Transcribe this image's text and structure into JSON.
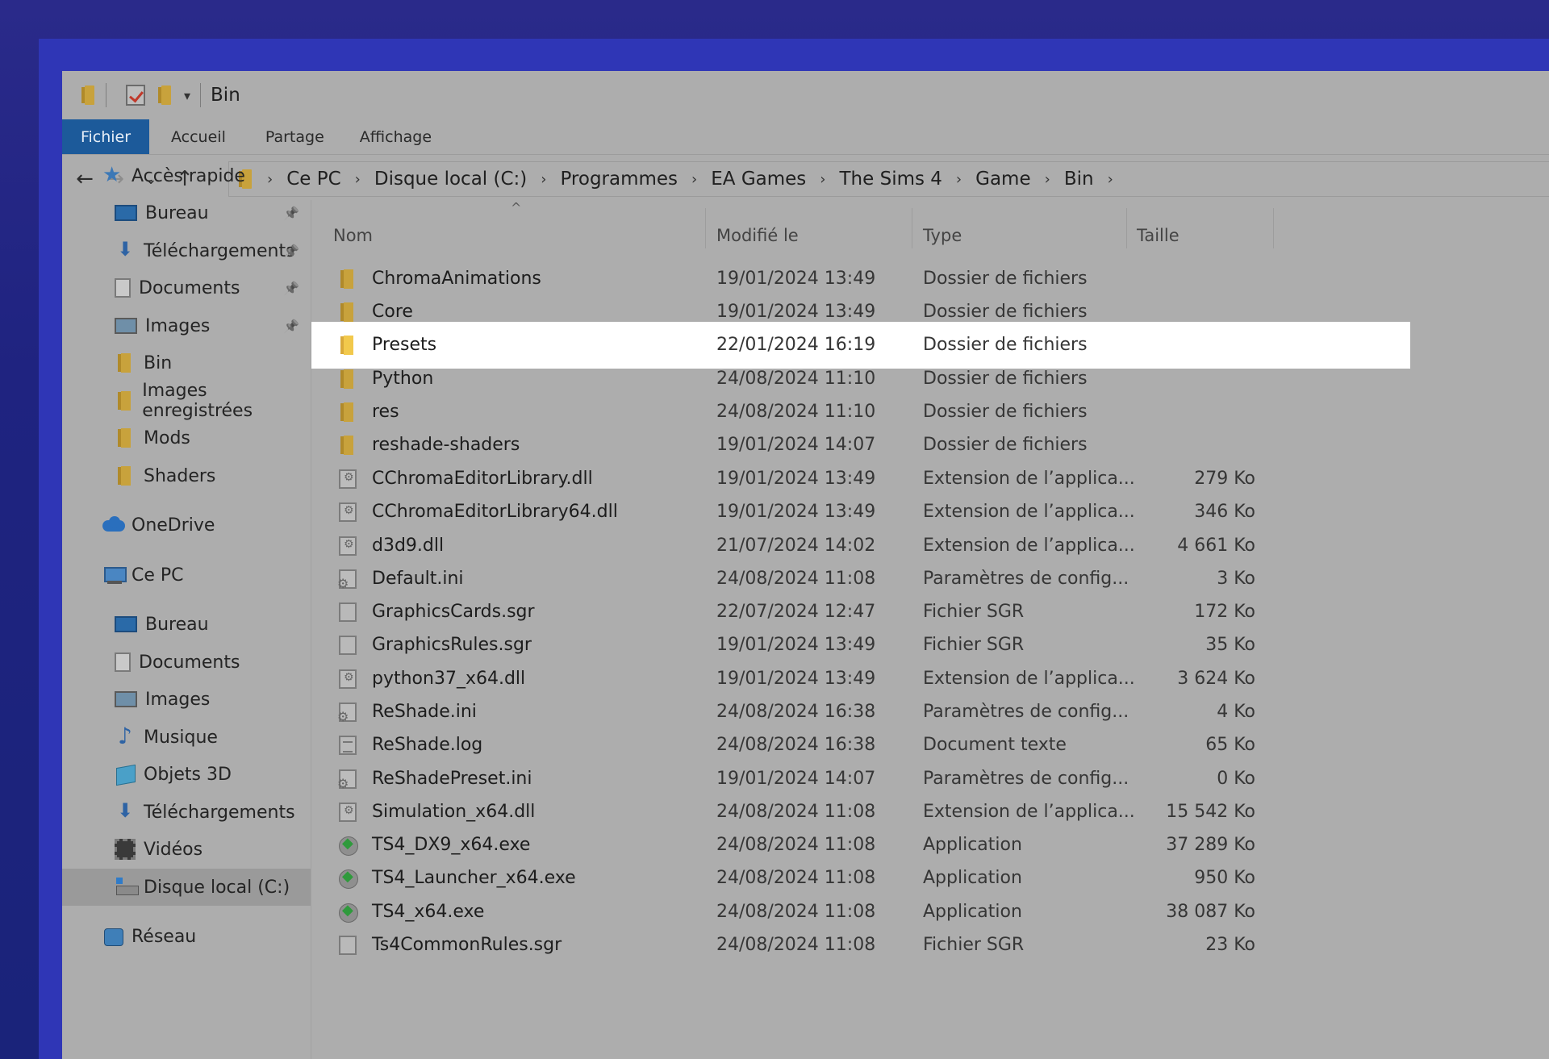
{
  "window": {
    "title": "Bin"
  },
  "ribbon": {
    "tabs": [
      "Fichier",
      "Accueil",
      "Partage",
      "Affichage"
    ]
  },
  "nav": {
    "back": "←",
    "forward": "→",
    "recent": "⌄",
    "up": "↑",
    "breadcrumbs": [
      "Ce PC",
      "Disque local (C:)",
      "Programmes",
      "EA Games",
      "The Sims 4",
      "Game",
      "Bin"
    ]
  },
  "sidebar": {
    "items": [
      {
        "label": "Accès rapide",
        "icon": "star-icon",
        "indent": 0,
        "pinned": false
      },
      {
        "label": "Bureau",
        "icon": "desktop-icon",
        "indent": 1,
        "pinned": true
      },
      {
        "label": "Téléchargements",
        "icon": "download-icon",
        "indent": 1,
        "pinned": true
      },
      {
        "label": "Documents",
        "icon": "documents-icon",
        "indent": 1,
        "pinned": true
      },
      {
        "label": "Images",
        "icon": "images-icon",
        "indent": 1,
        "pinned": true
      },
      {
        "label": "Bin",
        "icon": "folder-icon",
        "indent": 1,
        "pinned": false
      },
      {
        "label": "Images enregistrées",
        "icon": "folder-icon",
        "indent": 1,
        "pinned": false
      },
      {
        "label": "Mods",
        "icon": "folder-icon",
        "indent": 1,
        "pinned": false
      },
      {
        "label": "Shaders",
        "icon": "folder-icon",
        "indent": 1,
        "pinned": false
      },
      {
        "label": "OneDrive",
        "icon": "onedrive-icon",
        "indent": 0,
        "pinned": false
      },
      {
        "label": "Ce PC",
        "icon": "this-pc-icon",
        "indent": 0,
        "pinned": false
      },
      {
        "label": "Bureau",
        "icon": "desktop-icon",
        "indent": 1,
        "pinned": false
      },
      {
        "label": "Documents",
        "icon": "documents-icon",
        "indent": 1,
        "pinned": false
      },
      {
        "label": "Images",
        "icon": "images-icon",
        "indent": 1,
        "pinned": false
      },
      {
        "label": "Musique",
        "icon": "music-icon",
        "indent": 1,
        "pinned": false
      },
      {
        "label": "Objets 3D",
        "icon": "objects-3d-icon",
        "indent": 1,
        "pinned": false
      },
      {
        "label": "Téléchargements",
        "icon": "download-icon",
        "indent": 1,
        "pinned": false
      },
      {
        "label": "Vidéos",
        "icon": "videos-icon",
        "indent": 1,
        "pinned": false
      },
      {
        "label": "Disque local (C:)",
        "icon": "drive-icon",
        "indent": 1,
        "pinned": false,
        "selected": true
      },
      {
        "label": "Réseau",
        "icon": "network-icon",
        "indent": 0,
        "pinned": false
      }
    ]
  },
  "columns": {
    "name": "Nom",
    "modified": "Modifié le",
    "type": "Type",
    "size": "Taille"
  },
  "files": [
    {
      "name": "ChromaAnimations",
      "modified": "19/01/2024 13:49",
      "type": "Dossier de fichiers",
      "size": "",
      "kind": "folder"
    },
    {
      "name": "Core",
      "modified": "19/01/2024 13:49",
      "type": "Dossier de fichiers",
      "size": "",
      "kind": "folder"
    },
    {
      "name": "Presets",
      "modified": "22/01/2024 16:19",
      "type": "Dossier de fichiers",
      "size": "",
      "kind": "folder",
      "highlighted": true
    },
    {
      "name": "Python",
      "modified": "24/08/2024 11:10",
      "type": "Dossier de fichiers",
      "size": "",
      "kind": "folder"
    },
    {
      "name": "res",
      "modified": "24/08/2024 11:10",
      "type": "Dossier de fichiers",
      "size": "",
      "kind": "folder"
    },
    {
      "name": "reshade-shaders",
      "modified": "19/01/2024 14:07",
      "type": "Dossier de fichiers",
      "size": "",
      "kind": "folder"
    },
    {
      "name": "CChromaEditorLibrary.dll",
      "modified": "19/01/2024 13:49",
      "type": "Extension de l’applica...",
      "size": "279 Ko",
      "kind": "dll"
    },
    {
      "name": "CChromaEditorLibrary64.dll",
      "modified": "19/01/2024 13:49",
      "type": "Extension de l’applica...",
      "size": "346 Ko",
      "kind": "dll"
    },
    {
      "name": "d3d9.dll",
      "modified": "21/07/2024 14:02",
      "type": "Extension de l’applica...",
      "size": "4 661 Ko",
      "kind": "dll"
    },
    {
      "name": "Default.ini",
      "modified": "24/08/2024 11:08",
      "type": "Paramètres de config...",
      "size": "3 Ko",
      "kind": "ini"
    },
    {
      "name": "GraphicsCards.sgr",
      "modified": "22/07/2024 12:47",
      "type": "Fichier SGR",
      "size": "172 Ko",
      "kind": "file"
    },
    {
      "name": "GraphicsRules.sgr",
      "modified": "19/01/2024 13:49",
      "type": "Fichier SGR",
      "size": "35 Ko",
      "kind": "file"
    },
    {
      "name": "python37_x64.dll",
      "modified": "19/01/2024 13:49",
      "type": "Extension de l’applica...",
      "size": "3 624 Ko",
      "kind": "dll"
    },
    {
      "name": "ReShade.ini",
      "modified": "24/08/2024 16:38",
      "type": "Paramètres de config...",
      "size": "4 Ko",
      "kind": "ini"
    },
    {
      "name": "ReShade.log",
      "modified": "24/08/2024 16:38",
      "type": "Document texte",
      "size": "65 Ko",
      "kind": "log"
    },
    {
      "name": "ReShadePreset.ini",
      "modified": "19/01/2024 14:07",
      "type": "Paramètres de config...",
      "size": "0 Ko",
      "kind": "ini"
    },
    {
      "name": "Simulation_x64.dll",
      "modified": "24/08/2024 11:08",
      "type": "Extension de l’applica...",
      "size": "15 542 Ko",
      "kind": "dll"
    },
    {
      "name": "TS4_DX9_x64.exe",
      "modified": "24/08/2024 11:08",
      "type": "Application",
      "size": "37 289 Ko",
      "kind": "exe"
    },
    {
      "name": "TS4_Launcher_x64.exe",
      "modified": "24/08/2024 11:08",
      "type": "Application",
      "size": "950 Ko",
      "kind": "exe"
    },
    {
      "name": "TS4_x64.exe",
      "modified": "24/08/2024 11:08",
      "type": "Application",
      "size": "38 087 Ko",
      "kind": "exe"
    },
    {
      "name": "Ts4CommonRules.sgr",
      "modified": "24/08/2024 11:08",
      "type": "Fichier SGR",
      "size": "23 Ko",
      "kind": "file"
    }
  ],
  "colors": {
    "accent": "#1c5a9a",
    "highlight": "#ffffff",
    "window_bg": "#adadad",
    "desktop": "#1f2380"
  }
}
